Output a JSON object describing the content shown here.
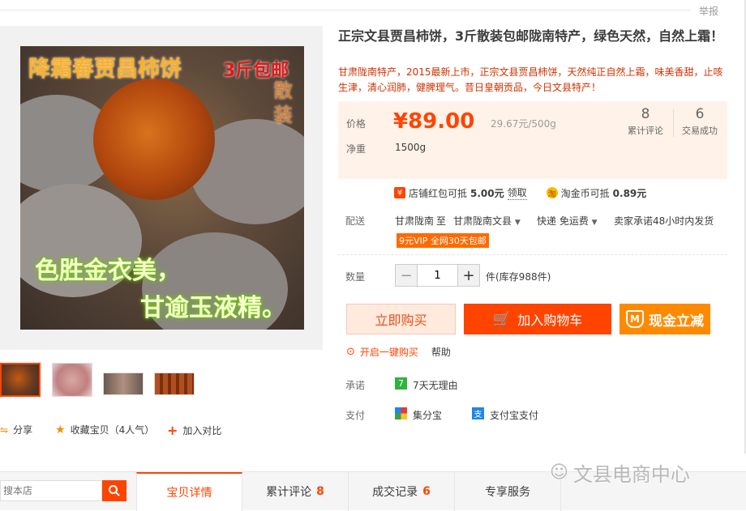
{
  "header": {
    "report_label": "举报"
  },
  "product": {
    "title": "正宗文县贾昌柿饼，3斤散装包邮陇南特产，绿色天然，自然上霜！",
    "subtitle": "甘肃陇南特产，2015最新上市，正宗文县贾昌柿饼，天然纯正自然上霜，味美香甜，止咳生津，清心润肺，健脾理气。昔日皇朝贡品，今日文县特产！",
    "image_text": {
      "line1": "降霜春贾昌柿饼",
      "line2": "3斤包邮",
      "line3": "散装",
      "line4": "色胜金衣美，",
      "line5": "甘逾玉液精。"
    }
  },
  "price_box": {
    "price_label": "价格",
    "price": "¥89.00",
    "unit_price": "29.67元/500g",
    "weight_label": "净重",
    "weight": "1500g",
    "reviews_count": "8",
    "reviews_label": "累计评论",
    "deals_count": "6",
    "deals_label": "交易成功"
  },
  "coupons": {
    "shop_coupon_pre": "店铺红包可抵",
    "shop_coupon_amount": "5.00元",
    "shop_coupon_action": "领取",
    "tao_coin_pre": "淘金币可抵",
    "tao_coin_amount": "0.89元"
  },
  "shipping": {
    "label": "配送",
    "from": "甘肃陇南",
    "to_word": "至",
    "to": "甘肃陇南文县",
    "method": "快递 免运费",
    "promise": "卖家承诺48小时内发货",
    "vip": "9元VIP 全网30天包邮"
  },
  "quantity": {
    "label": "数量",
    "value": "1",
    "stock": "件(库存988件)"
  },
  "buttons": {
    "buy_now": "立即购买",
    "add_cart": "加入购物车",
    "cash_discount": "现金立减",
    "onekey": "开启一键购买",
    "help": "帮助"
  },
  "promise": {
    "label": "承诺",
    "text": "7天无理由"
  },
  "pay": {
    "label": "支付",
    "option1": "集分宝",
    "option2": "支付宝支付"
  },
  "gallery_actions": {
    "share": "分享",
    "favorite": "收藏宝贝（4人气）",
    "compare": "加入对比"
  },
  "bottom_bar": {
    "search_placeholder": "搜本店",
    "tabs": [
      {
        "label": "宝贝详情",
        "count": ""
      },
      {
        "label": "累计评论",
        "count": "8"
      },
      {
        "label": "成交记录",
        "count": "6"
      },
      {
        "label": "专享服务",
        "count": ""
      }
    ]
  },
  "watermark": "文县电商中心",
  "colors": {
    "accent": "#ff4400",
    "price_bg": "#fff2e8",
    "cash_button": "#ff8a00"
  }
}
